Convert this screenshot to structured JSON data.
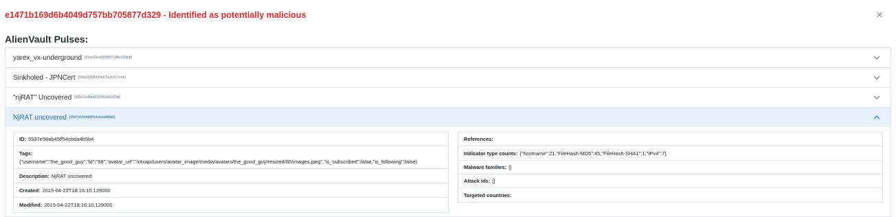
{
  "header": {
    "title": "e1471b169d6b4049d757bb705877d329 - Identified as potentially malicious",
    "close_glyph": "×"
  },
  "section": {
    "title": "AlienVault Pulses:"
  },
  "pulses": [
    {
      "name": "yarex_vx-underground",
      "id": "[61ee34ce0808f97188c050bdf]"
    },
    {
      "name": "Sinkholed - JPNCert",
      "id": "[58ea2068b694d73a3c517e3a]"
    },
    {
      "name": "\"njRAT\" Uncovered",
      "id": "[58b211d8d403f23558f3d26d]"
    },
    {
      "name": "NjRAT uncovered",
      "id": "[5537e56ab45ff54cbda4b5b4]"
    }
  ],
  "details": {
    "id_label": "ID:",
    "id_value": "5537e56ab45ff54cbda4b5b4",
    "tags_label": "Tags:",
    "tags_value": "{\"username\":\"the_good_guy\",\"id\":\"38\",\"avatar_url\":\"/otxapi/users/avatar_image/media/avatars/the_good_guy/resized/80/images.jpeg\",\"is_subscribed\":false,\"is_following\":false}",
    "description_label": "Description:",
    "description_value": "NjRAT uncovered",
    "created_label": "Created:",
    "created_value": "2015-04-22T18:16:10.129000",
    "modified_label": "Modified:",
    "modified_value": "2015-04-22T18:16:10.129000",
    "references_label": "References:",
    "indicator_label": "Indicator type counts:",
    "indicator_value": "{\"hostname\":21,\"FileHash-MD5\":45,\"FileHash-SHA1\":1,\"IPv4\":7}",
    "malware_label": "Malware families:",
    "malware_value": "[]",
    "attack_label": "Attack ids:",
    "attack_value": "[]",
    "countries_label": "Targeted countries:"
  },
  "colors": {
    "title_red": "#e8262b",
    "active_blue": "#2d73c7",
    "active_bg": "#e7f1fc",
    "border": "#dfe3e7"
  }
}
